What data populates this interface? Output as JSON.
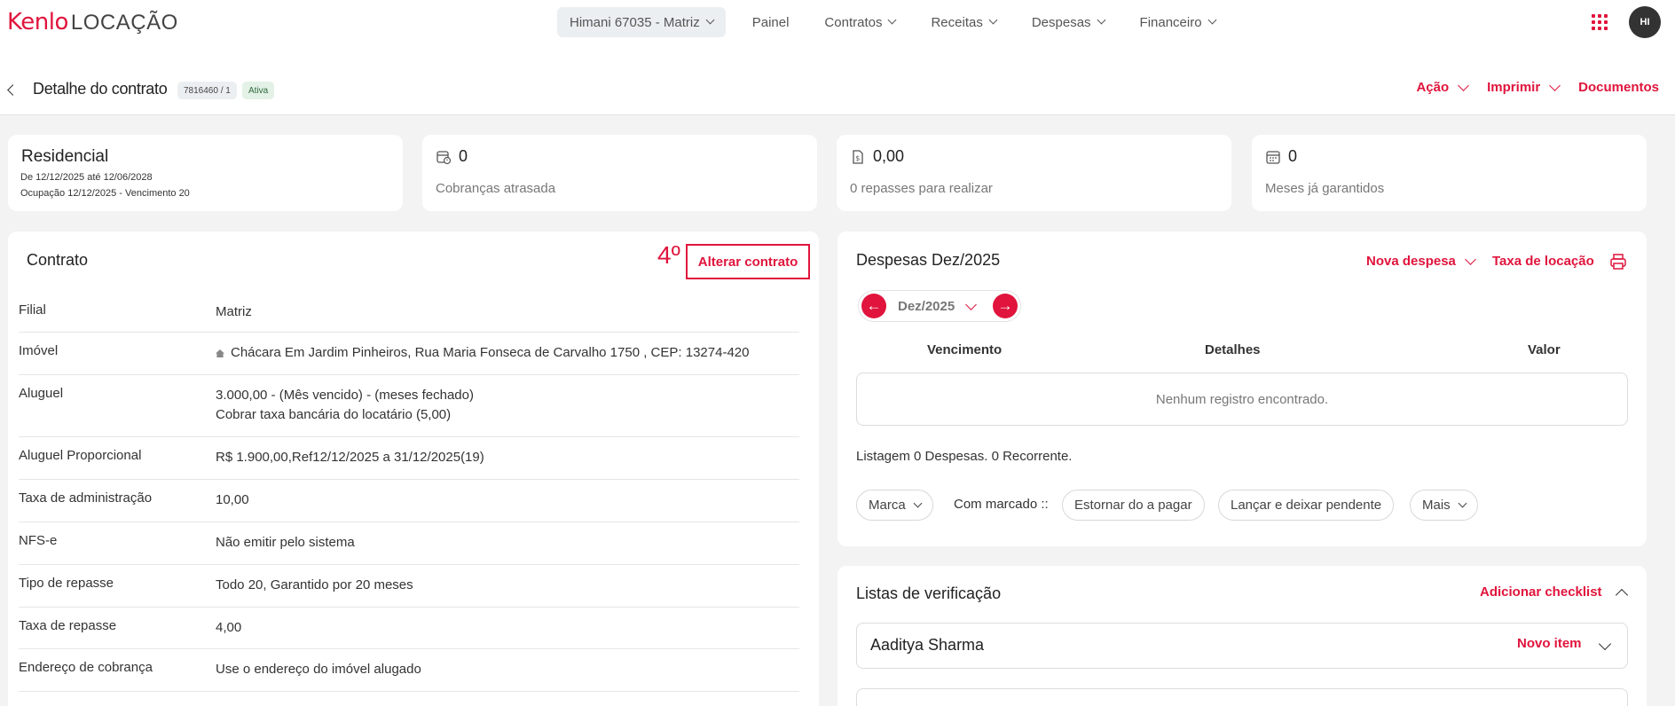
{
  "brand": {
    "logo_k": "Kenlo",
    "logo_l": "LOCAÇÃO"
  },
  "nav": {
    "branch": "Himani 67035 - Matriz",
    "items": [
      "Painel",
      "Contratos",
      "Receitas",
      "Despesas",
      "Financeiro"
    ]
  },
  "user": {
    "initials": "HI"
  },
  "header": {
    "title": "Detalhe do contrato",
    "contract_number": "7816460 / 1",
    "status": "Ativa",
    "actions": {
      "acao": "Ação",
      "imprimir": "Imprimir",
      "documentos": "Documentos"
    }
  },
  "stats": {
    "residencial": {
      "title": "Residencial",
      "period": "De 12/12/2025 até 12/06/2028",
      "occupation": "Ocupação 12/12/2025 - Vencimento 20"
    },
    "cobrancas": {
      "value": "0",
      "label": "Cobranças atrasada"
    },
    "repasses": {
      "value": "0,00",
      "label": "0 repasses para realizar"
    },
    "meses": {
      "value": "0",
      "label": "Meses já garantidos"
    }
  },
  "contrato": {
    "title": "Contrato",
    "annotation": "4º",
    "alter_button": "Alterar contrato",
    "rows": [
      {
        "label": "Filial",
        "value": "Matriz",
        "value2": ""
      },
      {
        "label": "Imóvel",
        "value": "Chácara Em Jardim Pinheiros, Rua Maria Fonseca de Carvalho 1750 , CEP: 13274-420",
        "value2": ""
      },
      {
        "label": "Aluguel",
        "value": "3.000,00 - (Mês vencido) - (meses fechado)",
        "value2": "Cobrar taxa bancária do locatário (5,00)"
      },
      {
        "label": "Aluguel Proporcional",
        "value": "R$ 1.900,00,Ref12/12/2025 a 31/12/2025(19)",
        "value2": ""
      },
      {
        "label": "Taxa de administração",
        "value": "10,00",
        "value2": ""
      },
      {
        "label": "NFS-e",
        "value": "Não emitir pelo sistema",
        "value2": ""
      },
      {
        "label": "Tipo de repasse",
        "value": "Todo 20, Garantido por 20 meses",
        "value2": ""
      },
      {
        "label": "Taxa de repasse",
        "value": "4,00",
        "value2": ""
      },
      {
        "label": "Endereço de cobrança",
        "value": "Use o endereço do imóvel alugado",
        "value2": ""
      }
    ]
  },
  "despesas": {
    "title": "Despesas Dez/2025",
    "nova_despesa": "Nova despesa",
    "taxa_locacao": "Taxa de locação",
    "month": "Dez/2025",
    "columns": {
      "vencimento": "Vencimento",
      "detalhes": "Detalhes",
      "valor": "Valor"
    },
    "empty": "Nenhum registro encontrado.",
    "listing": "Listagem 0 Despesas. 0 Recorrente.",
    "marca": "Marca",
    "com_marcado": "Com marcado ::",
    "estornar": "Estornar do a pagar",
    "lancar": "Lançar e deixar pendente",
    "mais": "Mais"
  },
  "checklists": {
    "title": "Listas de verificação",
    "add": "Adicionar checklist",
    "items": [
      {
        "name": "Aaditya Sharma",
        "action": "Novo item"
      }
    ]
  }
}
